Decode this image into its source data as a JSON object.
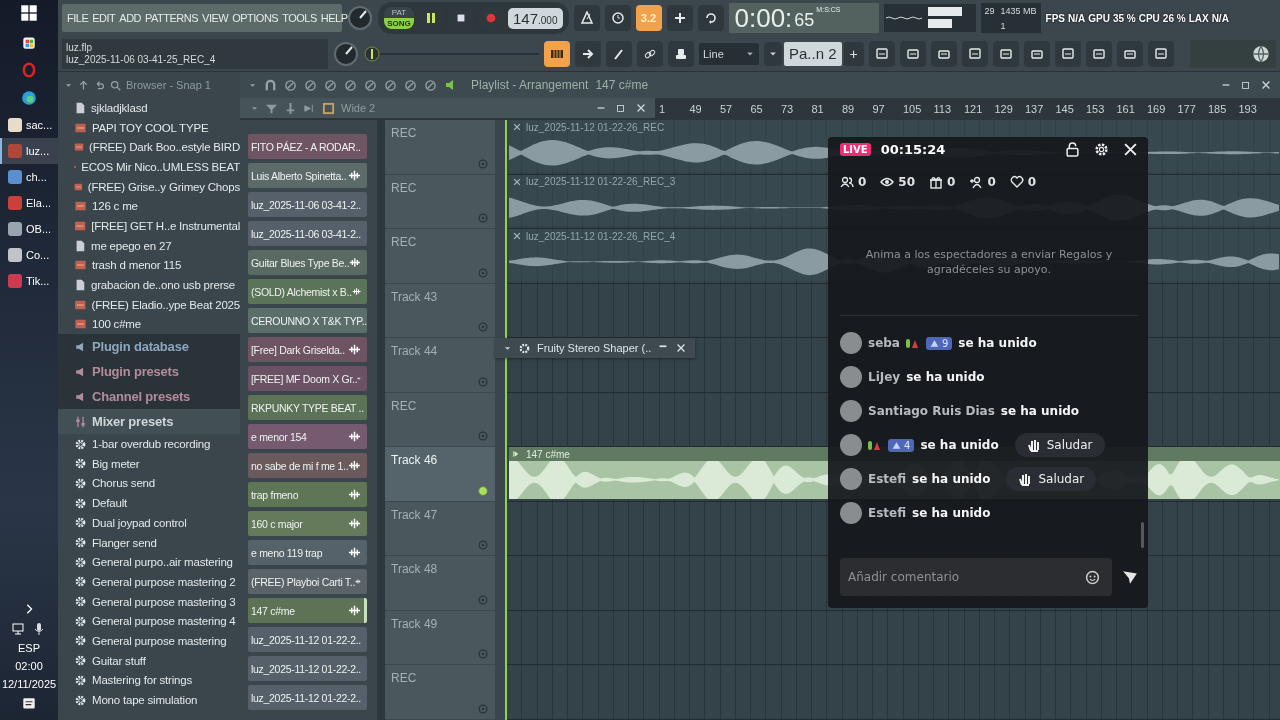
{
  "taskbar": {
    "apps": [
      {
        "label": "sac...",
        "selected": false
      },
      {
        "label": "luz...",
        "selected": true
      },
      {
        "label": "ch...",
        "selected": false
      },
      {
        "label": "Ela...",
        "selected": false
      },
      {
        "label": "OB...",
        "selected": false
      },
      {
        "label": "Co...",
        "selected": false
      },
      {
        "label": "Tik...",
        "selected": false
      }
    ],
    "language": "ESP",
    "time": "02:00",
    "date": "12/11/2025"
  },
  "menu": [
    "FILE",
    "EDIT",
    "ADD",
    "PATTERNS",
    "VIEW",
    "OPTIONS",
    "TOOLS",
    "HELP"
  ],
  "project": {
    "file": "luz.flp",
    "hint": "luz_2025-11-06 03-41-25_REC_4"
  },
  "transport": {
    "modes": [
      {
        "label": "PAT",
        "selected": false
      },
      {
        "label": "SONG",
        "selected": true
      }
    ],
    "playing": true,
    "tempo": "147",
    "tempo_decimals": ".000"
  },
  "tool_badge": "3.2",
  "pitch_slider": {
    "level": 0
  },
  "time": {
    "units": "M:S:CS",
    "main": "0:00:",
    "centiseconds": "65"
  },
  "monitor": {
    "cpu": "29",
    "memory": "1435 MB",
    "polyphony": "1"
  },
  "overlay_stats": [
    {
      "label": "FPS",
      "value": "N/A"
    },
    {
      "label": "GPU",
      "value": "35 %"
    },
    {
      "label": "CPU",
      "value": "26 %"
    },
    {
      "label": "LAX",
      "value": "N/A"
    }
  ],
  "snap": "Line",
  "pattern": {
    "name": "Pa..n 2",
    "add": "+"
  },
  "browser": {
    "title": "Browser - Snap 1",
    "items": [
      {
        "kind": "file",
        "label": "sjkladjklasd"
      },
      {
        "kind": "audio",
        "label": "PAPI TOY COOL TYPE"
      },
      {
        "kind": "audio",
        "label": "(FREE) Dark Boo..estyle  BIRD"
      },
      {
        "kind": "audio",
        "label": "ECOS Mir Nico..UMLESS BEAT"
      },
      {
        "kind": "audio",
        "label": "(FREE) Grise..y Grimey Chops"
      },
      {
        "kind": "audio",
        "label": "126 c me"
      },
      {
        "kind": "audio",
        "label": "[FREE] GET H..e Instrumental"
      },
      {
        "kind": "file",
        "label": "me epego en 27"
      },
      {
        "kind": "audio",
        "label": "trash d menor 115"
      },
      {
        "kind": "file",
        "label": "grabacion de..ono usb prerse"
      },
      {
        "kind": "audio",
        "label": "(FREE) Eladio..ype Beat 2025"
      },
      {
        "kind": "audio",
        "label": "100 c#me"
      },
      {
        "kind": "category",
        "label": "Plugin database",
        "color": "#8fa6bf"
      },
      {
        "kind": "category",
        "label": "Plugin presets",
        "color": "#b58b9c"
      },
      {
        "kind": "category",
        "label": "Channel presets",
        "color": "#b58b9c"
      },
      {
        "kind": "section",
        "label": "Mixer presets"
      },
      {
        "kind": "preset",
        "label": "1-bar overdub recording"
      },
      {
        "kind": "preset",
        "label": "Big meter"
      },
      {
        "kind": "preset",
        "label": "Chorus send"
      },
      {
        "kind": "preset",
        "label": "Default"
      },
      {
        "kind": "preset",
        "label": "Dual joypad control"
      },
      {
        "kind": "preset",
        "label": "Flanger send"
      },
      {
        "kind": "preset",
        "label": "General purpo..air mastering"
      },
      {
        "kind": "preset",
        "label": "General purpose mastering 2"
      },
      {
        "kind": "preset",
        "label": "General purpose mastering 3"
      },
      {
        "kind": "preset",
        "label": "General purpose mastering 4"
      },
      {
        "kind": "preset",
        "label": "General purpose mastering"
      },
      {
        "kind": "preset",
        "label": "Guitar stuff"
      },
      {
        "kind": "preset",
        "label": "Mastering for strings"
      },
      {
        "kind": "preset",
        "label": "Mono tape simulation"
      }
    ]
  },
  "channel_rack": {
    "title": "Wide 2",
    "channels": [
      {
        "name": "FITO PÁEZ - A RODAR..",
        "kind": "sample",
        "color": "#6f5563",
        "selected": false
      },
      {
        "name": "Luis Alberto Spinetta..",
        "kind": "sample",
        "color": "#5c6a6a",
        "selected": false
      },
      {
        "name": "luz_2025-11-06 03-41-2..",
        "kind": "audio",
        "color": "#56606a",
        "selected": false
      },
      {
        "name": "luz_2025-11-06 03-41-2..",
        "kind": "audio",
        "color": "#56606a",
        "selected": false
      },
      {
        "name": "Guitar Blues Type Be..",
        "kind": "sample",
        "color": "#5a6a62",
        "selected": false
      },
      {
        "name": "(SOLD) Alchemist x B..",
        "kind": "sample",
        "color": "#5b7358",
        "selected": false
      },
      {
        "name": "CEROUNNO X T&K TYP..",
        "kind": "sample",
        "color": "#5c6e6a",
        "selected": false
      },
      {
        "name": "[Free] Dark Griselda..",
        "kind": "sample",
        "color": "#6e5462",
        "selected": false
      },
      {
        "name": "[FREE] MF Doom X Gr..",
        "kind": "sample",
        "color": "#6a5264",
        "selected": false
      },
      {
        "name": "RKPUNKY TYPE BEAT ..",
        "kind": "sample",
        "color": "#5d7358",
        "selected": false
      },
      {
        "name": "e menor 154",
        "kind": "sample",
        "color": "#765a70",
        "selected": false
      },
      {
        "name": "no sabe de mi f me 1..",
        "kind": "sample",
        "color": "#6a5a5e",
        "selected": false
      },
      {
        "name": "trap fmeno",
        "kind": "sample",
        "color": "#5f7656",
        "selected": false
      },
      {
        "name": "160 c major",
        "kind": "sample",
        "color": "#657a5a",
        "selected": false
      },
      {
        "name": "e meno 119 trap",
        "kind": "sample",
        "color": "#56626a",
        "selected": false
      },
      {
        "name": "(FREE) Playboi Carti T..",
        "kind": "sample",
        "color": "#5a6468",
        "selected": false
      },
      {
        "name": "147 c#me",
        "kind": "sample",
        "color": "#5e7256",
        "selected": true
      },
      {
        "name": "luz_2025-11-12 01-22-2..",
        "kind": "audio",
        "color": "#55606a",
        "selected": false
      },
      {
        "name": "luz_2025-11-12 01-22-2..",
        "kind": "audio",
        "color": "#55606a",
        "selected": false
      },
      {
        "name": "luz_2025-11-12 01-22-2..",
        "kind": "audio",
        "color": "#55606a",
        "selected": false
      }
    ]
  },
  "playlist": {
    "title": "Playlist - Arrangement",
    "pattern": "147 c#me",
    "ruler": [
      "1",
      "49",
      "57",
      "65",
      "73",
      "81",
      "89",
      "97",
      "105",
      "113",
      "121",
      "129",
      "137",
      "145",
      "153",
      "161",
      "169",
      "177",
      "185",
      "193"
    ],
    "tracks": [
      {
        "name": "REC",
        "selected": false,
        "clip": {
          "kind": "audio",
          "label": "luz_2025-11-12 01-22-26_REC"
        }
      },
      {
        "name": "REC",
        "selected": false,
        "clip": {
          "kind": "audio",
          "label": "luz_2025-11-12 01-22-26_REC_3"
        }
      },
      {
        "name": "REC",
        "selected": false,
        "clip": {
          "kind": "audio",
          "label": "luz_2025-11-12 01-22-26_REC_4"
        }
      },
      {
        "name": "Track 43",
        "selected": false
      },
      {
        "name": "Track 44",
        "selected": false
      },
      {
        "name": "REC",
        "selected": false
      },
      {
        "name": "Track 46",
        "selected": true,
        "clip": {
          "kind": "pattern",
          "label": "147 c#me"
        }
      },
      {
        "name": "Track 47",
        "selected": false
      },
      {
        "name": "Track 48",
        "selected": false
      },
      {
        "name": "Track 49",
        "selected": false
      },
      {
        "name": "REC",
        "selected": false
      }
    ]
  },
  "plugin_window": {
    "title": "Fruity Stereo Shaper (.."
  },
  "live": {
    "badge": "LIVE",
    "duration": "00:15:24",
    "stats": [
      {
        "kind": "members",
        "value": "0"
      },
      {
        "kind": "views",
        "value": "50"
      },
      {
        "kind": "gifts",
        "value": "0"
      },
      {
        "kind": "follows",
        "value": "0"
      },
      {
        "kind": "likes",
        "value": "0"
      }
    ],
    "prompt": "Anima a los espectadores a enviar Regalos y agradéceles su apoyo.",
    "chat": [
      {
        "user": "seba",
        "decorated": true,
        "level": "9",
        "action": "se ha unido"
      },
      {
        "user": "LiJey",
        "decorated": false,
        "action": "se ha unido"
      },
      {
        "user": "Santiago Ruis Dias",
        "decorated": false,
        "action": "se ha unido"
      },
      {
        "decorated": true,
        "level": "4",
        "action": "se ha unido",
        "greet": "Saludar"
      },
      {
        "user": "Estefi",
        "decorated": false,
        "action": "se ha unido",
        "greet": "Saludar"
      },
      {
        "user": "Estefi",
        "decorated": false,
        "action": "se ha unido"
      }
    ],
    "comment_placeholder": "Añadir comentario"
  }
}
